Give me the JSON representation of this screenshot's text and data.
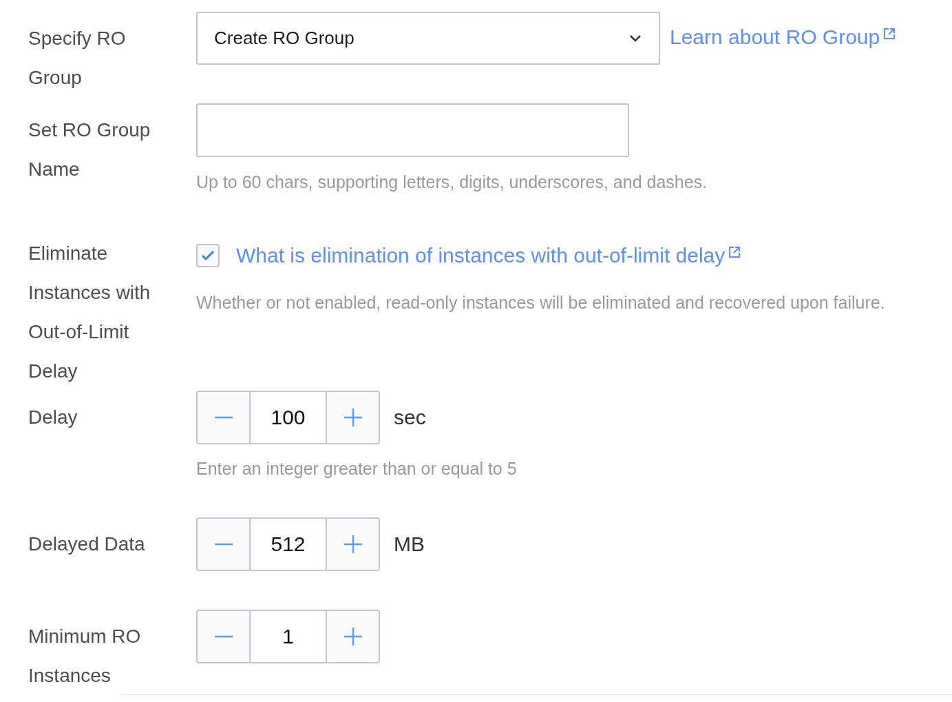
{
  "fields": [
    {
      "kind": "select",
      "label": "Specify RO Group",
      "value": "Create RO Group",
      "link": "Learn about RO Group"
    },
    {
      "kind": "text",
      "label": "Set RO Group Name",
      "hint": "Up to 60 chars, supporting letters, digits, underscores, and dashes."
    },
    {
      "kind": "checkbox",
      "label": "Eliminate Instances with Out-of-Limit Delay",
      "checked": true,
      "link": "What is elimination of instances with out-of-limit delay",
      "hint": "Whether or not enabled, read-only instances will be eliminated and recovered upon failure."
    },
    {
      "kind": "number",
      "label": "Delay",
      "value": "100",
      "unit": "sec",
      "hint": "Enter an integer greater than or equal to 5"
    },
    {
      "kind": "number",
      "label": "Delayed Data",
      "value": "512",
      "unit": "MB"
    },
    {
      "kind": "number",
      "label": "Minimum RO Instances",
      "value": "1"
    }
  ]
}
